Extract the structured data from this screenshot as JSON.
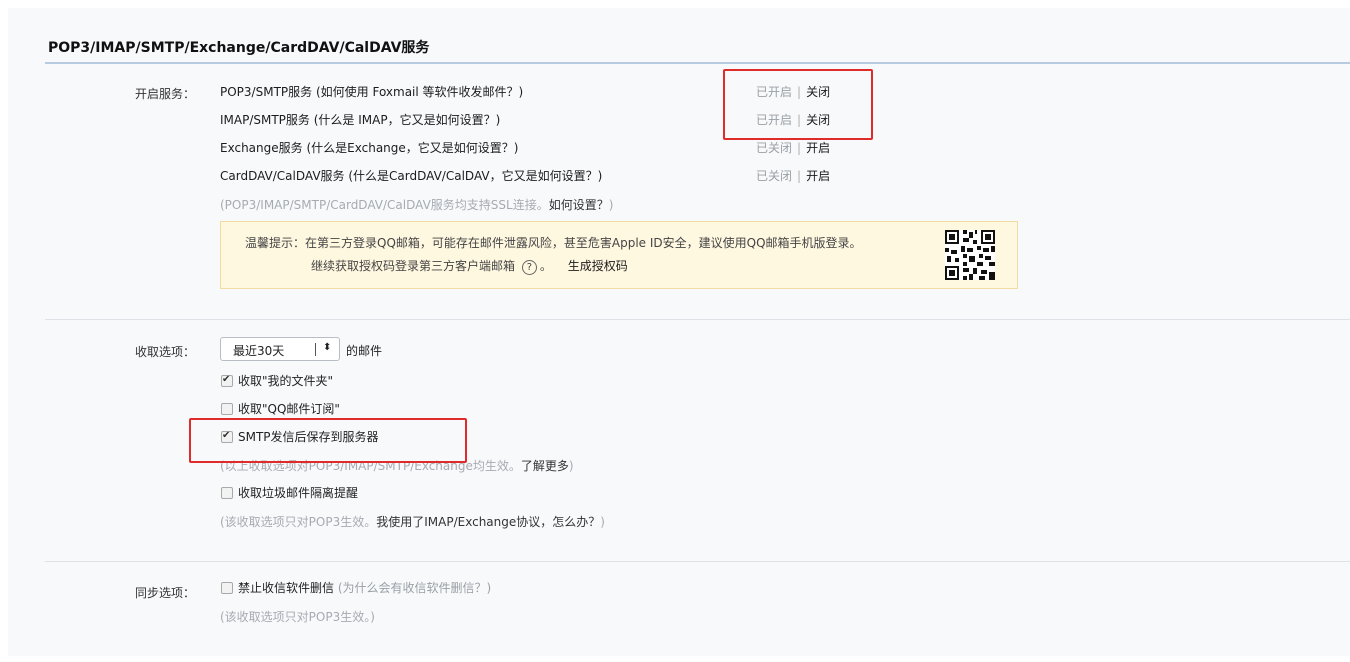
{
  "page_title": "POP3/IMAP/SMTP/Exchange/CardDAV/CalDAV服务",
  "services": {
    "label": "开启服务：",
    "items": [
      {
        "name": "POP3/SMTP服务",
        "help": "(如何使用 Foxmail 等软件收发邮件？)",
        "state": "已开启",
        "action": "关闭"
      },
      {
        "name": "IMAP/SMTP服务",
        "help": "(什么是 IMAP，它又是如何设置？)",
        "state": "已开启",
        "action": "关闭"
      },
      {
        "name": "Exchange服务",
        "help": "(什么是Exchange，它又是如何设置？)",
        "state": "已关闭",
        "action": "开启"
      },
      {
        "name": "CardDAV/CalDAV服务",
        "help": "(什么是CardDAV/CalDAV，它又是如何设置？)",
        "state": "已关闭",
        "action": "开启"
      }
    ],
    "ssl_note_prefix": "(POP3/IMAP/SMTP/CardDAV/CalDAV服务均支持SSL连接。",
    "ssl_note_link": "如何设置？",
    "ssl_note_suffix": ")",
    "separator": "|"
  },
  "notice": {
    "line1": "温馨提示：在第三方登录QQ邮箱，可能存在邮件泄露风险，甚至危害Apple ID安全，建议使用QQ邮箱手机版登录。",
    "line2_prefix": "继续获取授权码登录第三方客户端邮箱",
    "help_glyph": "?",
    "line2_suffix": "。",
    "generate_link": "生成授权码",
    "qr_icon": "qr-code-icon"
  },
  "receive": {
    "label": "收取选项：",
    "period_value": "最近30天",
    "period_suffix": "的邮件",
    "options": [
      {
        "label": "收取\"我的文件夹\"",
        "checked": true
      },
      {
        "label": "收取\"QQ邮件订阅\"",
        "checked": false
      },
      {
        "label": "SMTP发信后保存到服务器",
        "checked": true
      }
    ],
    "note1_prefix": "(以上收取选项对POP3/IMAP/SMTP/Exchange均生效。",
    "note1_link": "了解更多",
    "note1_suffix": ")",
    "spam_option": {
      "label": "收取垃圾邮件隔离提醒",
      "checked": false
    },
    "note2_prefix": "(该收取选项只对POP3生效。",
    "note2_link": "我使用了IMAP/Exchange协议，怎么办？",
    "note2_suffix": ")"
  },
  "sync": {
    "label": "同步选项：",
    "option": {
      "label": "禁止收信软件删信",
      "checked": false
    },
    "help": "(为什么会有收信软件删信？)",
    "note": "(该收取选项只对POP3生效。)"
  },
  "colors": {
    "highlight": "#e02b2b",
    "notice_bg": "#fff8e1",
    "notice_border": "#f2dba0"
  }
}
